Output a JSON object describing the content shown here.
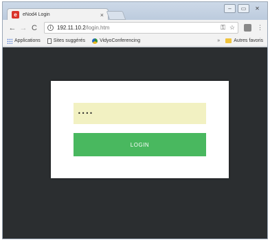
{
  "browser": {
    "tab": {
      "title": "eNod4 Login",
      "close_glyph": "×",
      "favicon_letter": "e"
    },
    "window_controls": [
      "–",
      "▭",
      "✕"
    ],
    "toolbar": {
      "back_glyph": "←",
      "forward_glyph": "→",
      "reload_glyph": "C",
      "url_host": "192.11.10.2",
      "url_path": "/login.htm",
      "key_glyph": "⚿",
      "star_glyph": "☆",
      "menu_glyph": "⋮"
    },
    "bookmarks": {
      "apps_label": "Applications",
      "suggested_label": "Sites suggérés",
      "vidyo_label": "VidyoConferencing",
      "overflow_glyph": "»",
      "other_label": "Autres favoris"
    }
  },
  "login": {
    "password_value": "••••",
    "button_label": "LOGIN"
  },
  "colors": {
    "page_background": "#2b2e30",
    "input_background": "#f2f1c2",
    "button_background": "#49b85f"
  },
  "icons": {
    "tab_favicon": "enod4-favicon",
    "info": "info-icon",
    "key": "key-icon",
    "star": "star-icon",
    "extension": "extension-icon",
    "menu": "kebab-menu-icon",
    "apps": "apps-grid-icon",
    "page": "page-icon",
    "vidyo": "vidyo-icon",
    "folder": "folder-icon"
  }
}
